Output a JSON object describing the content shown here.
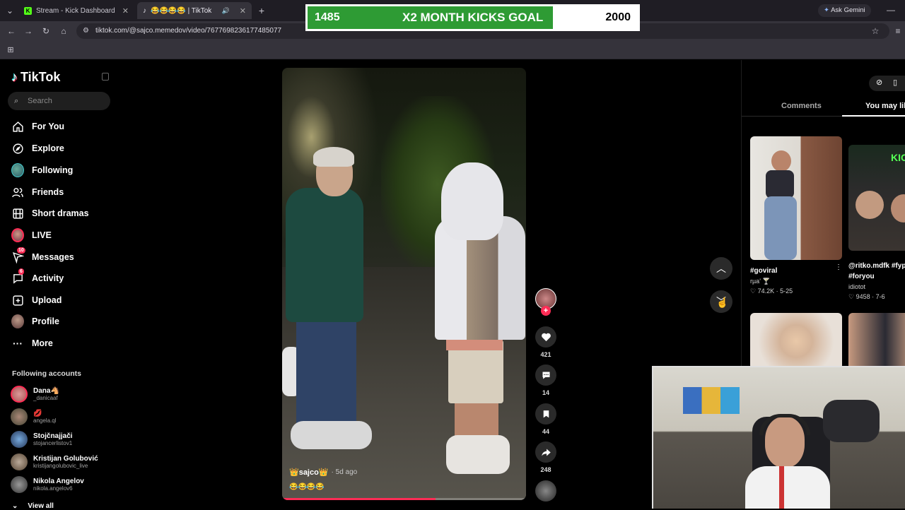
{
  "browser": {
    "tabs": [
      {
        "title": "Stream - Kick Dashboard",
        "active": false
      },
      {
        "title": "😂😂😂😂 | TikTok",
        "active": true
      }
    ],
    "new_tab": "+",
    "url": "tiktok.com/@sajco.memedov/video/7677698236177485077",
    "ask_gemini": "Ask Gemini"
  },
  "goal": {
    "current": "1485",
    "label": "X2 MONTH KICKS GOAL",
    "target": "2000",
    "progress": 0.7425,
    "fill_color": "#2e9b34"
  },
  "sidebar": {
    "logo": "TikTok",
    "search_placeholder": "Search",
    "nav": [
      {
        "label": "For You",
        "icon": "home-icon"
      },
      {
        "label": "Explore",
        "icon": "compass-icon"
      },
      {
        "label": "Following",
        "icon": "following-avatar-icon"
      },
      {
        "label": "Friends",
        "icon": "friends-icon"
      },
      {
        "label": "Short dramas",
        "icon": "film-icon"
      },
      {
        "label": "LIVE",
        "icon": "live-avatar-icon"
      },
      {
        "label": "Messages",
        "icon": "send-icon",
        "badge": "10"
      },
      {
        "label": "Activity",
        "icon": "inbox-icon",
        "badge": "6"
      },
      {
        "label": "Upload",
        "icon": "plus-square-icon"
      },
      {
        "label": "Profile",
        "icon": "profile-avatar-icon"
      },
      {
        "label": "More",
        "icon": "more-dots-icon"
      }
    ],
    "following_title": "Following accounts",
    "accounts": [
      {
        "name": "Dana🐴",
        "handle": "_danicaaf"
      },
      {
        "name": "💋",
        "handle": "angela.ql"
      },
      {
        "name": "Stojčnajjači",
        "handle": "stojancerlistov1"
      },
      {
        "name": "Kristijan Golubović",
        "handle": "kristijangolubovic_live"
      },
      {
        "name": "Nikola Angelov",
        "handle": "nikola.angelov6"
      }
    ],
    "view_all": "View all"
  },
  "video": {
    "author": "👑sajco👑",
    "time": "· 5d ago",
    "caption": "😂😂😂😂",
    "progress": 0.63
  },
  "actions": {
    "likes": "421",
    "comments": "14",
    "saves": "44",
    "shares": "248"
  },
  "right_panel": {
    "tabs": [
      "Comments",
      "You may like"
    ],
    "cards": [
      {
        "title": "#goviral",
        "author": "rµa' 🍸",
        "likes": "74.2K",
        "date": "5-25"
      },
      {
        "title": "@ritko.mdfk #fyp #goviral #foryou",
        "author": "idiotot",
        "likes": "9458",
        "date": "7-6"
      }
    ]
  }
}
